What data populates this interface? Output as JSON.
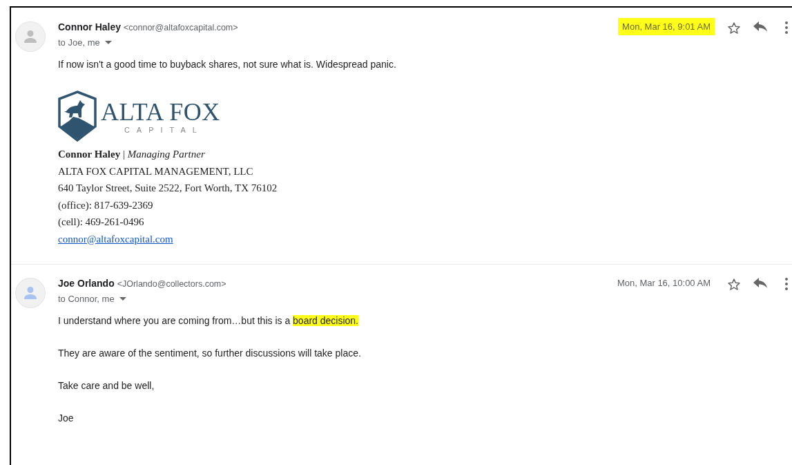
{
  "messages": [
    {
      "sender": {
        "name": "Connor Haley",
        "email": "<connor@altafoxcapital.com>"
      },
      "avatar": {
        "color": "#bdbdbd"
      },
      "recipients": "to Joe, me",
      "date": {
        "text": "Mon, Mar 16, 9:01 AM",
        "highlighted": true
      },
      "body": [
        [
          {
            "text": "If now isn't a good time to buyback shares, not sure what is. Widespread panic.",
            "highlighted": false
          }
        ]
      ],
      "signature": {
        "logo": {
          "name": "ALTA FOX",
          "subtitle": "CAPITAL"
        },
        "lines": [
          {
            "kind": "text",
            "text": "**Connor Haley** | *Managing Partner*"
          },
          {
            "kind": "text",
            "text": "ALTA FOX CAPITAL MANAGEMENT, LLC"
          },
          {
            "kind": "text",
            "text": "640 Taylor Street, Suite 2522, Fort Worth, TX 76102"
          },
          {
            "kind": "text",
            "text": "(office): 817-639-2369"
          },
          {
            "kind": "text",
            "text": "(cell): 469-261-0496"
          },
          {
            "kind": "link",
            "text": "connor@altafoxcapital.com"
          }
        ]
      }
    },
    {
      "sender": {
        "name": "Joe Orlando",
        "email": "<JOrlando@collectors.com>"
      },
      "avatar": {
        "color": "#a8c3f0"
      },
      "recipients": "to Connor, me",
      "date": {
        "text": "Mon, Mar 16, 10:00 AM",
        "highlighted": false
      },
      "body": [
        [
          {
            "text": "I understand where you are coming from…but this is a ",
            "highlighted": false
          },
          {
            "text": "board decision.",
            "highlighted": true
          }
        ],
        [
          {
            "text": "They are aware of the sentiment, so further discussions will take place.",
            "highlighted": false
          }
        ],
        [
          {
            "text": "Take care and be well,",
            "highlighted": false
          }
        ],
        [
          {
            "text": "Joe",
            "highlighted": false
          }
        ]
      ]
    }
  ]
}
